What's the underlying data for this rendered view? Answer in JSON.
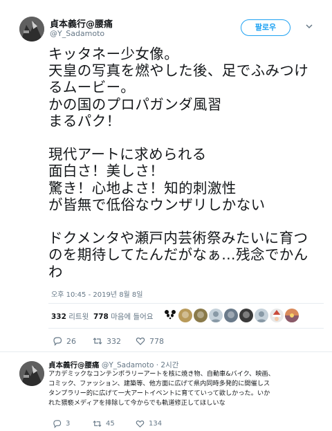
{
  "tweet": {
    "display_name": "貞本義行@腰痛",
    "handle": "@Y_Sadamoto",
    "follow_label": "팔로우",
    "text": "キッタネー少女像。\n天皇の写真を燃やした後、足でふみつけ\nるムービー。\nかの国のプロパガンダ風習\nまるパク！\n\n現代アートに求められる\n面白さ！美しさ！\n驚き！心地よさ！知的刺激性\nが皆無で低俗なウンザリしかない\n\nドクメンタや瀬戸内芸術祭みたいに育つ\nのを期待してたんだがなぁ…残念でかん\nわ",
    "timestamp": "오후 10:45 - 2019년 8월 8일",
    "retweet_count": "332",
    "retweet_label": "리트윗",
    "like_count": "778",
    "like_label": "마음에 들어요",
    "actions": {
      "reply_count": "26",
      "retweet_count": "332",
      "like_count": "778"
    },
    "likers": [
      {
        "icon": "panda-avatar",
        "color": "#2b2b2b"
      },
      {
        "icon": "dog-avatar",
        "color": "#b89a5a"
      },
      {
        "icon": "character-avatar",
        "color": "#8a7a4a"
      },
      {
        "icon": "default-avatar",
        "color": "#c5d1da"
      },
      {
        "icon": "photo-avatar",
        "color": "#6a7a8a"
      },
      {
        "icon": "face-avatar",
        "color": "#3a3a3a"
      },
      {
        "icon": "default-avatar",
        "color": "#c5d1da"
      },
      {
        "icon": "santa-avatar",
        "color": "#c94a3a"
      },
      {
        "icon": "sunset-avatar",
        "color": "#8a5a6a"
      }
    ]
  },
  "reply": {
    "display_name": "貞本義行@腰痛",
    "handle": "@Y_Sadamoto",
    "time": "· 2시간",
    "text": "アカデミックなコンテンポラリーアートを核に焼き物、自動車&バイク、映画、\nコミック、ファッション、建築等、他方面に広げて県内同時多発的に開催しス\nタンプラリー的に広げて一大アートイベントに育てていって欲しかった。いか\nれた猥褻メディアを排除して今からでも軌道修正してほしいな",
    "actions": {
      "reply_count": "3",
      "retweet_count": "45",
      "like_count": "134"
    }
  },
  "colors": {
    "accent": "#1da1f2",
    "secondary_text": "#657786",
    "divider": "#e6ecf0"
  }
}
